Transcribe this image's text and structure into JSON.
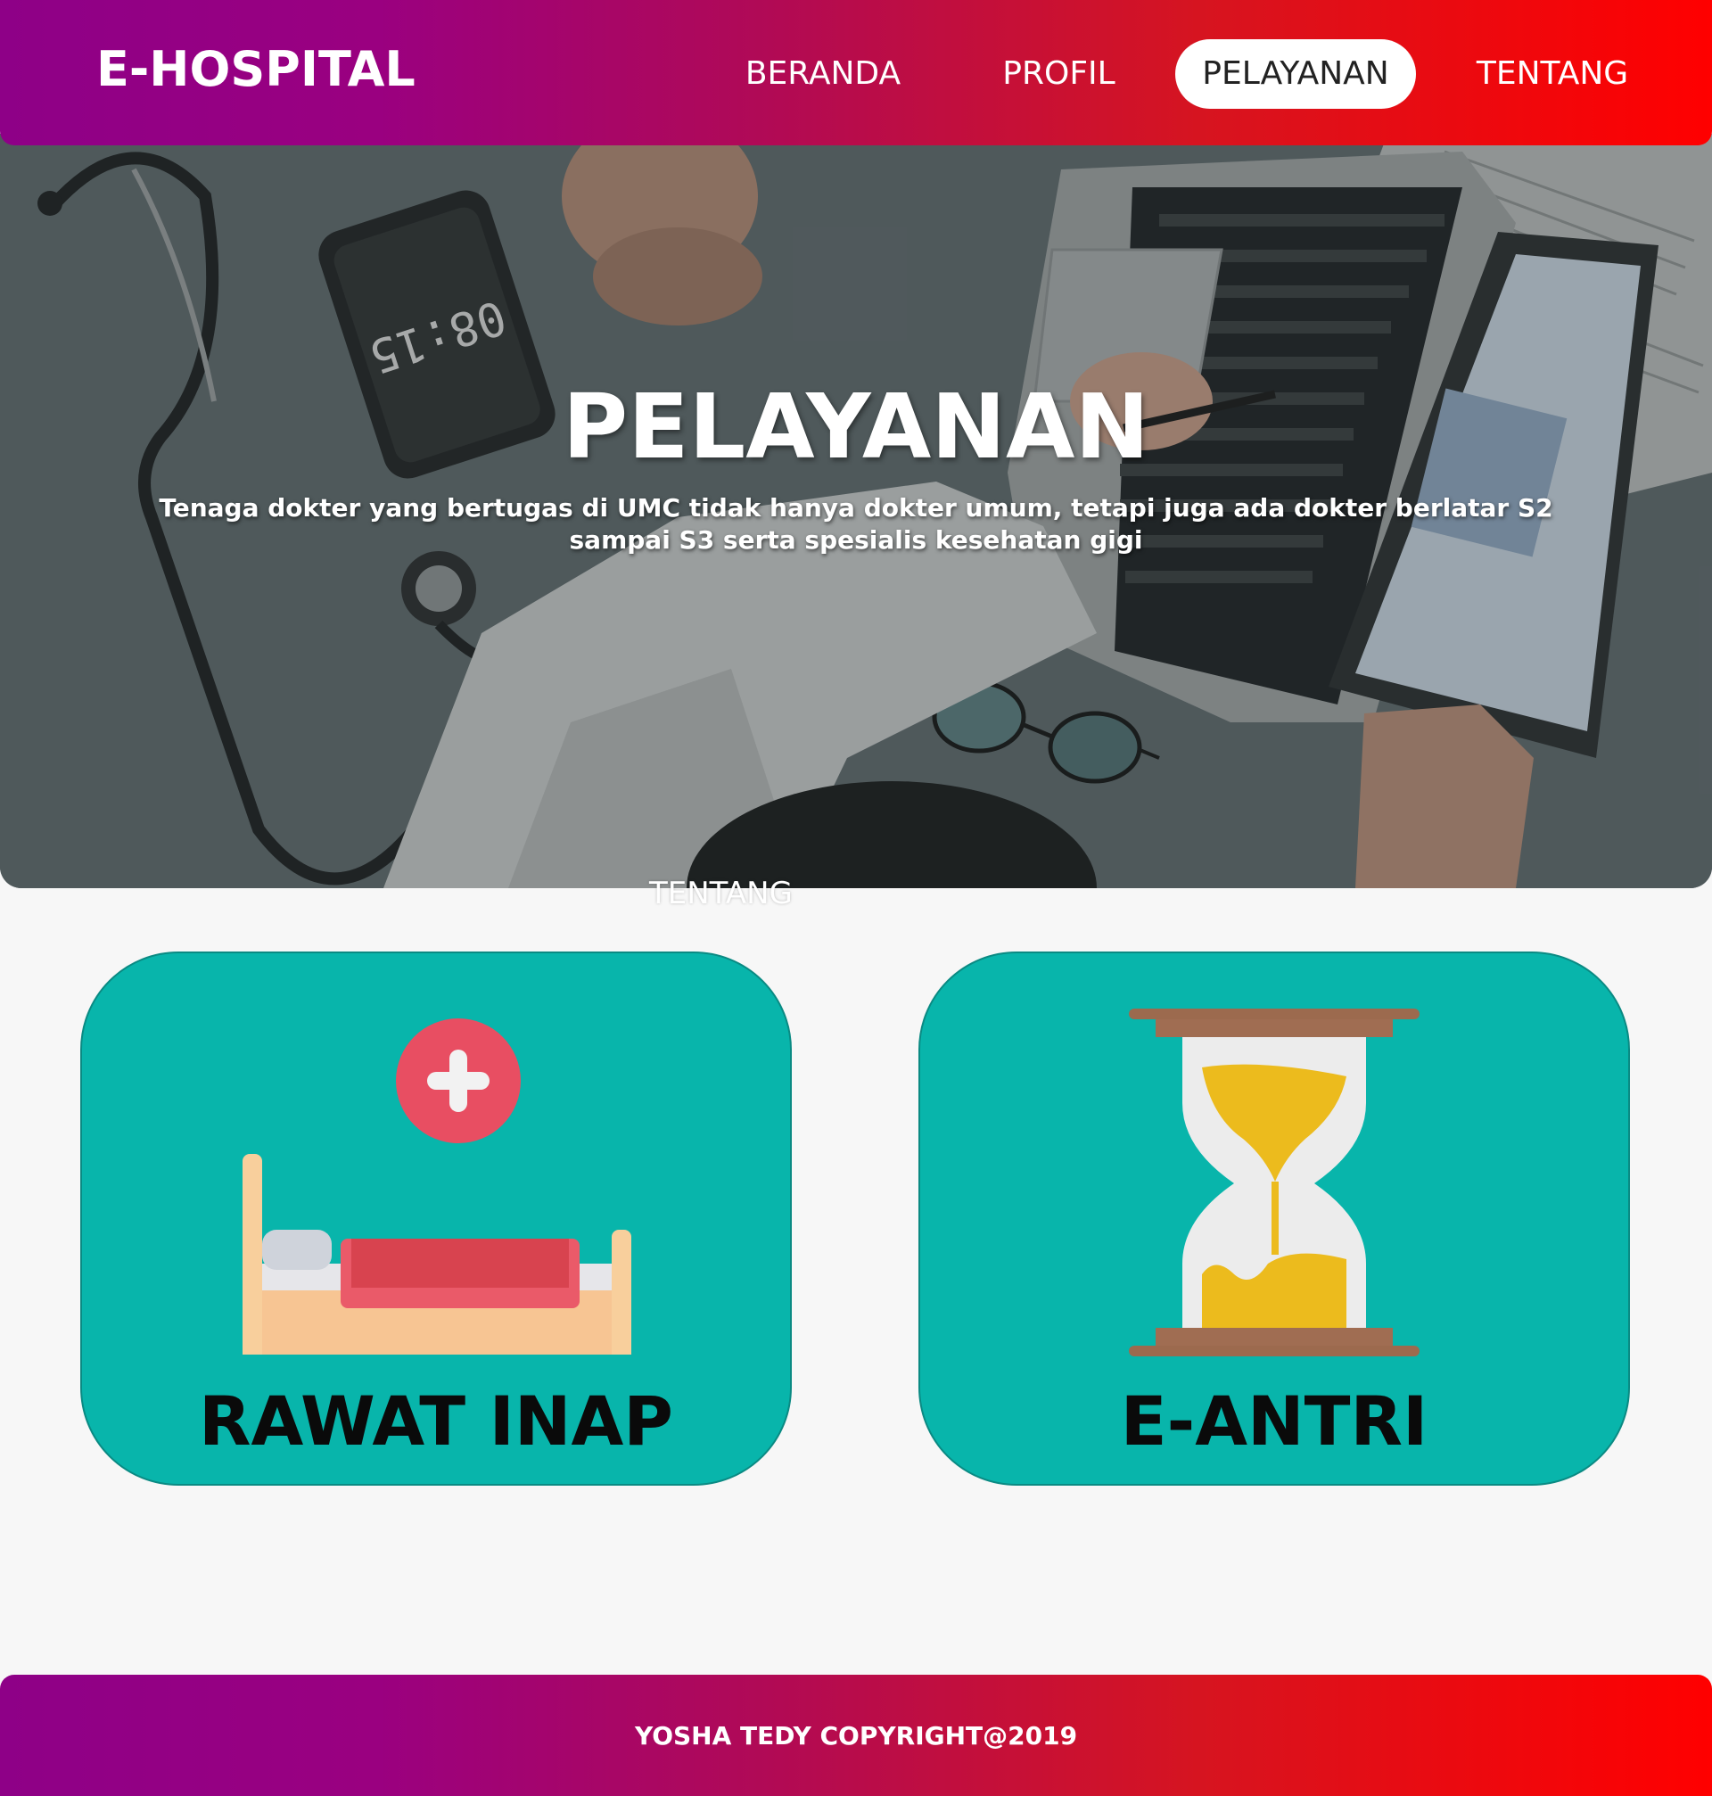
{
  "navbar": {
    "brand": "E-HOSPITAL",
    "items": [
      {
        "label": "BERANDA",
        "active": false
      },
      {
        "label": "PROFIL",
        "active": false
      },
      {
        "label": "PELAYANAN",
        "active": true
      },
      {
        "label": "TENTANG",
        "active": false
      }
    ]
  },
  "hero": {
    "title": "PELAYANAN",
    "description": "Tenaga dokter yang bertugas di UMC tidak hanya dokter umum, tetapi juga ada dokter berlatar S2 sampai S3 serta spesialis kesehatan gigi",
    "phone_clock": "08:15",
    "overflow_link": "TENTANG"
  },
  "services": [
    {
      "label": "RAWAT INAP",
      "icon": "hospital-bed-icon"
    },
    {
      "label": "E-ANTRI",
      "icon": "hourglass-icon"
    }
  ],
  "footer": {
    "copyright": "YOSHA TEDY COPYRIGHT@2019"
  },
  "colors": {
    "gradient_start": "#8e0087",
    "gradient_end": "#ff0000",
    "card": "#08b5ab",
    "background": "#f7f7f7"
  }
}
